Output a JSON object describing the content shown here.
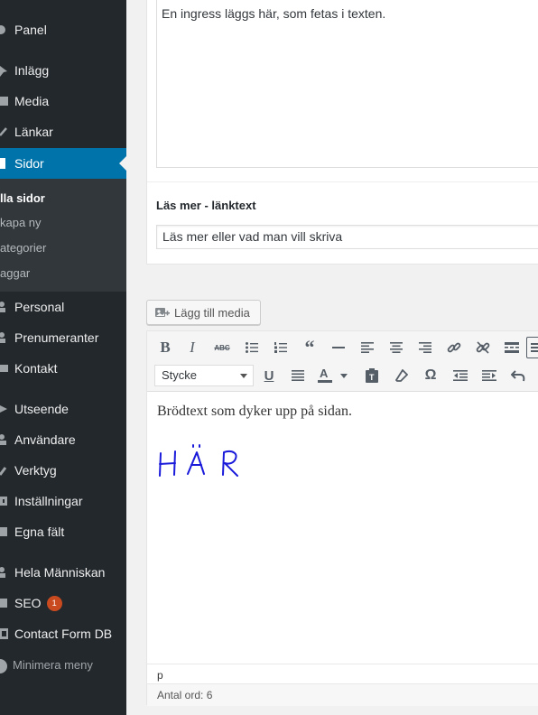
{
  "sidebar": {
    "menu": [
      {
        "label": "Panel",
        "icon": "dashboard-icon"
      },
      {
        "label": "Inlägg",
        "icon": "pin-icon"
      },
      {
        "label": "Media",
        "icon": "media-icon"
      },
      {
        "label": "Länkar",
        "icon": "link-icon"
      },
      {
        "label": "Sidor",
        "icon": "pages-icon",
        "current": true
      },
      {
        "label": "Personal",
        "icon": "people-icon"
      },
      {
        "label": "Prenumeranter",
        "icon": "people-icon"
      },
      {
        "label": "Kontakt",
        "icon": "email-icon"
      },
      {
        "label": "Utseende",
        "icon": "brush-icon"
      },
      {
        "label": "Användare",
        "icon": "user-icon"
      },
      {
        "label": "Verktyg",
        "icon": "wrench-icon"
      },
      {
        "label": "Inställningar",
        "icon": "settings-icon"
      },
      {
        "label": "Egna fält",
        "icon": "fields-icon"
      },
      {
        "label": "Hela Människan",
        "icon": "people-icon"
      },
      {
        "label": "SEO",
        "icon": "seo-icon",
        "badge": "1"
      },
      {
        "label": "Contact Form DB",
        "icon": "database-icon"
      }
    ],
    "submenu": [
      "lla sidor",
      "kapa ny",
      "ategorier",
      "aggar"
    ],
    "collapse_label": "Minimera meny"
  },
  "ingress": {
    "value": "En ingress läggs här, som fetas i texten."
  },
  "read_more": {
    "label": "Läs mer - länktext",
    "value": "Läs mer eller vad man vill skriva"
  },
  "editor": {
    "add_media_label": "Lägg till media",
    "format_select_value": "Stycke",
    "content_text": "Brödtext som dyker upp på sidan.",
    "handwritten_text": "HÄR",
    "path": "p",
    "word_count": "Antal ord: 6",
    "toolbar_row1": [
      "bold-icon",
      "italic-icon",
      "strikethrough-icon",
      "bullet-list-icon",
      "numbered-list-icon",
      "blockquote-icon",
      "horizontal-line-icon",
      "align-left-icon",
      "align-center-icon",
      "align-right-icon",
      "insert-link-icon",
      "remove-link-icon",
      "read-more-icon",
      "toolbar-toggle-icon"
    ],
    "toolbar_row2": [
      "underline-icon",
      "justify-icon",
      "text-color-icon",
      "paste-text-icon",
      "clear-formatting-icon",
      "special-character-icon",
      "outdent-icon",
      "indent-icon",
      "undo-icon"
    ]
  },
  "colors": {
    "sidebar_bg": "#23282d",
    "current_bg": "#0073aa",
    "badge": "#ca4a1f",
    "handwriting": "#1a1adb"
  }
}
